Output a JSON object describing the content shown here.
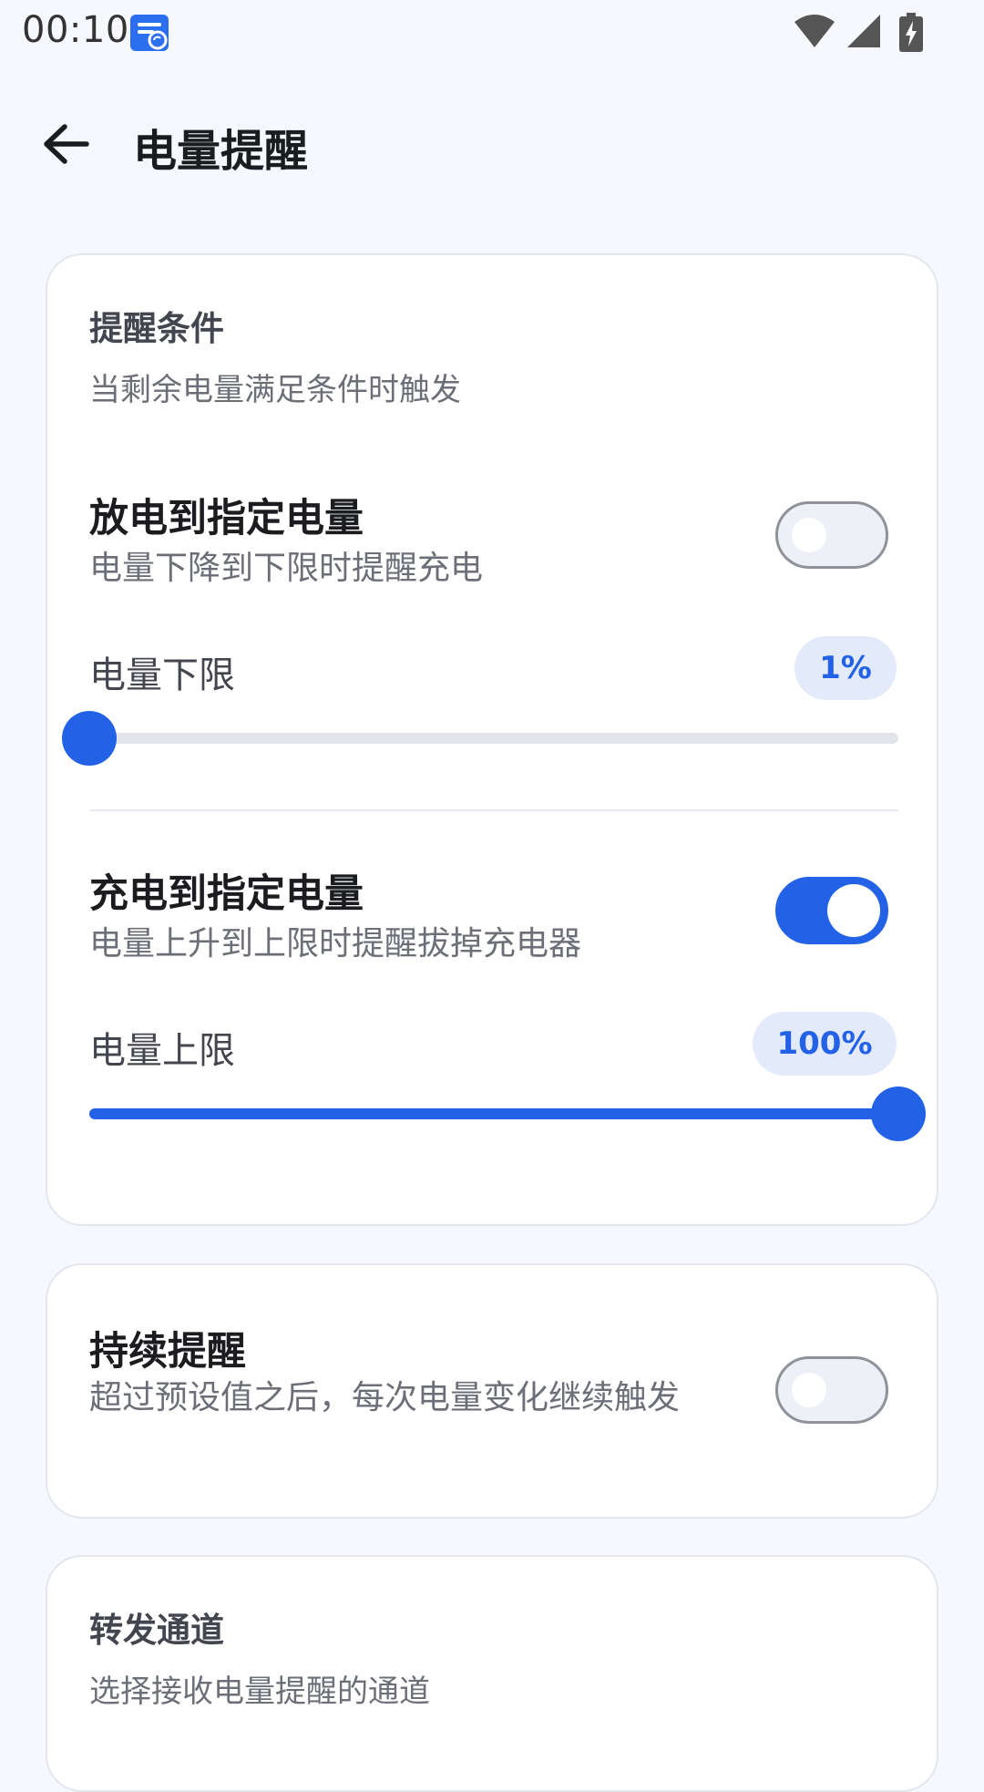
{
  "status_bar": {
    "time": "00:10",
    "notification_icon": "message-sync-icon",
    "wifi_icon": "wifi-icon",
    "signal_icon": "cellular-signal-icon",
    "battery_icon": "battery-charging-icon"
  },
  "app_bar": {
    "back_icon": "arrow-back-icon",
    "title": "电量提醒"
  },
  "conditions": {
    "title": "提醒条件",
    "subtitle": "当剩余电量满足条件时触发",
    "discharge": {
      "title": "放电到指定电量",
      "description": "电量下降到下限时提醒充电",
      "enabled": false,
      "slider_label": "电量下限",
      "value_text": "1%",
      "value": 1,
      "min": 1,
      "max": 100
    },
    "charge": {
      "title": "充电到指定电量",
      "description": "电量上升到上限时提醒拔掉充电器",
      "enabled": true,
      "slider_label": "电量上限",
      "value_text": "100%",
      "value": 100,
      "min": 1,
      "max": 100
    }
  },
  "continuous": {
    "title": "持续提醒",
    "description": "超过预设值之后，每次电量变化继续触发",
    "enabled": false
  },
  "channels": {
    "title": "转发通道",
    "subtitle": "选择接收电量提醒的通道"
  },
  "colors": {
    "accent": "#2362e6",
    "background": "#f6f8fd",
    "card": "#ffffff",
    "badge_bg": "#e3ebfb"
  }
}
